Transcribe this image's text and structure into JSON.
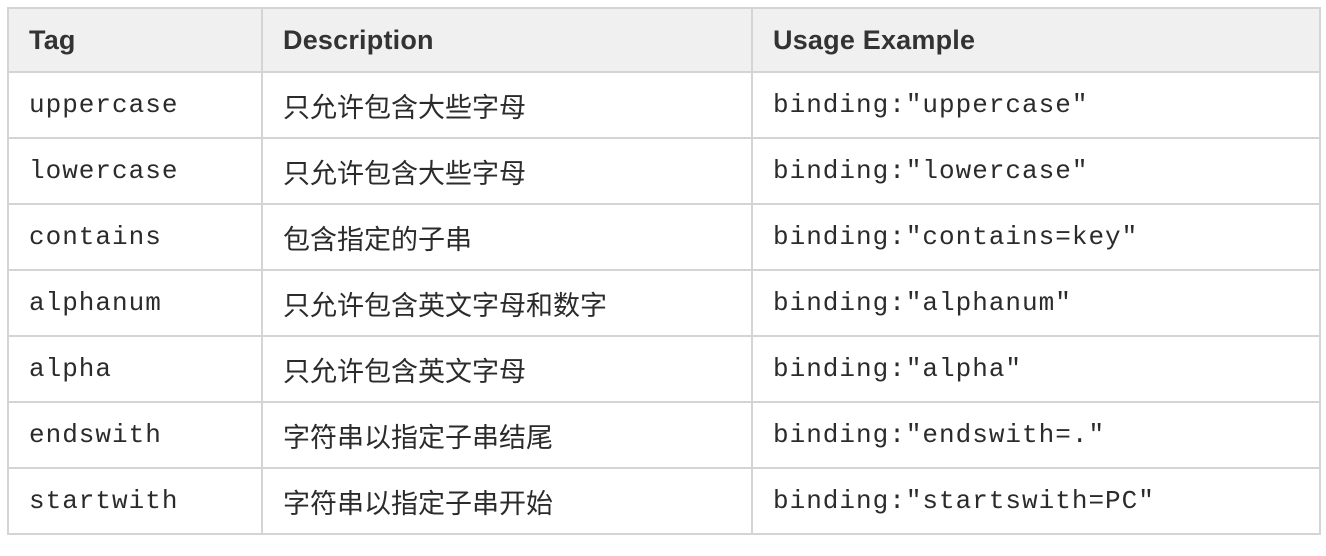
{
  "table": {
    "headers": [
      "Tag",
      "Description",
      "Usage Example"
    ],
    "rows": [
      {
        "tag": "uppercase",
        "description": "只允许包含大些字母",
        "example": "binding:\"uppercase\""
      },
      {
        "tag": "lowercase",
        "description": "只允许包含大些字母",
        "example": "binding:\"lowercase\""
      },
      {
        "tag": "contains",
        "description": "包含指定的子串",
        "example": "binding:\"contains=key\""
      },
      {
        "tag": "alphanum",
        "description": "只允许包含英文字母和数字",
        "example": "binding:\"alphanum\""
      },
      {
        "tag": "alpha",
        "description": "只允许包含英文字母",
        "example": "binding:\"alpha\""
      },
      {
        "tag": "endswith",
        "description": "字符串以指定子串结尾",
        "example": "binding:\"endswith=.\""
      },
      {
        "tag": "startwith",
        "description": "字符串以指定子串开始",
        "example": "binding:\"startswith=PC\""
      }
    ]
  },
  "colors": {
    "header_bg": "#f0f0f0",
    "border": "#d4d4d4",
    "text": "#2b2b2b"
  }
}
